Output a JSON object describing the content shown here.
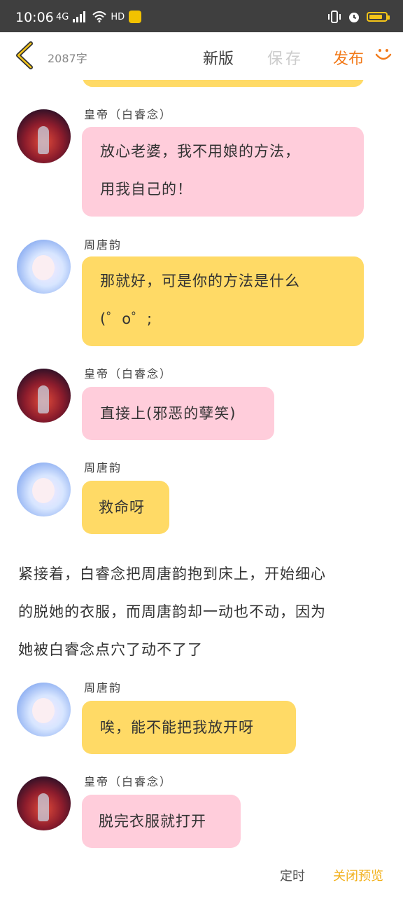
{
  "status_bar": {
    "time": "10:06",
    "network": "4G",
    "hd": "HD"
  },
  "header": {
    "word_count": "2087字",
    "new_label": "新版",
    "save_label": "保存",
    "publish_label": "发布"
  },
  "colors": {
    "accent_orange": "#f27a1a",
    "pink_bubble": "#ffcddb",
    "yellow_bubble": "#ffda66",
    "close_preview": "#f2b01a"
  },
  "messages": [
    {
      "speaker": "皇帝（白睿念）",
      "text_lines": [
        "放心老婆，我不用娘的方法，",
        "用我自己的！"
      ]
    },
    {
      "speaker": "周唐韵",
      "text_lines": [
        "那就好，可是你的方法是什么",
        "(゜o゜;"
      ]
    },
    {
      "speaker": "皇帝（白睿念）",
      "text_lines": [
        "直接上(邪恶的孽笑)"
      ]
    },
    {
      "speaker": "周唐韵",
      "text_lines": [
        "救命呀"
      ]
    },
    {
      "speaker": "周唐韵",
      "text_lines": [
        "唉，能不能把我放开呀"
      ]
    },
    {
      "speaker": "皇帝（白睿念）",
      "text_lines": [
        "脱完衣服就打开"
      ]
    }
  ],
  "narration_lines": [
    "紧接着，白睿念把周唐韵抱到床上，开始细心",
    "的脱她的衣服，而周唐韵却一动也不动，因为",
    "她被白睿念点穴了动不了了"
  ],
  "footer": {
    "timer_label": "定时",
    "close_preview_label": "关闭预览"
  }
}
